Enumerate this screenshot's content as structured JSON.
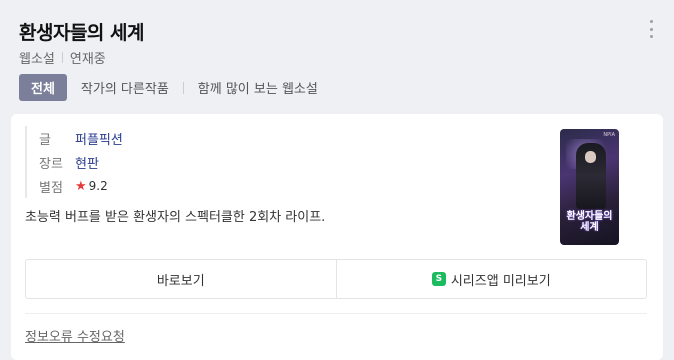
{
  "header": {
    "title": "환생자들의 세계",
    "category": "웹소설",
    "status": "연재중",
    "more_icon": "more-vertical-icon"
  },
  "tabs": [
    {
      "label": "전체",
      "active": true
    },
    {
      "label": "작가의 다른작품",
      "active": false
    },
    {
      "label": "함께 많이 보는 웹소설",
      "active": false
    }
  ],
  "info": {
    "author_label": "글",
    "author": "퍼플픽션",
    "genre_label": "장르",
    "genre": "현판",
    "rating_label": "별점",
    "rating_icon": "star-icon",
    "rating": "9.2"
  },
  "description": "초능력 버프를 받은 환생자의 스펙터클한 2회차 라이프.",
  "cover": {
    "title": "환생자들의 세계",
    "badge": "NPIA"
  },
  "buttons": {
    "view": "바로보기",
    "app_icon_text": "S",
    "app_preview": "시리즈앱 미리보기"
  },
  "report_link": "정보오류 수정요청",
  "colors": {
    "tab_active_bg": "#7b7f9a",
    "link_text": "#2a3b8f",
    "star": "#e53b3b",
    "series_app": "#1dbb5f"
  }
}
